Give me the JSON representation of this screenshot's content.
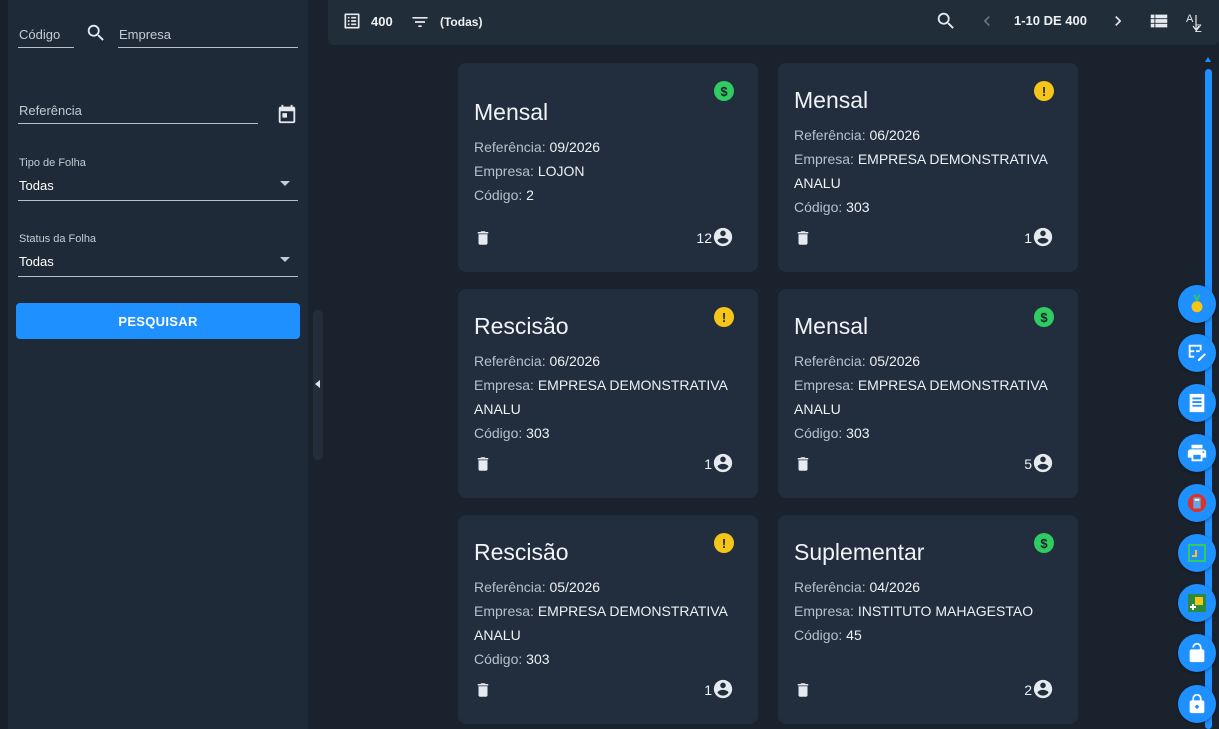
{
  "filters": {
    "codigo_placeholder": "Código",
    "empresa_placeholder": "Empresa",
    "referencia_placeholder": "Referência",
    "tipo_label": "Tipo de Folha",
    "tipo_value": "Todas",
    "status_label": "Status da Folha",
    "status_value": "Todas",
    "search_button": "PESQUISAR"
  },
  "toolbar": {
    "total": "400",
    "filter_text": "(Todas)",
    "pagination": "1-10 DE 400"
  },
  "labels": {
    "referencia": "Referência: ",
    "empresa": "Empresa: ",
    "codigo": "Código: "
  },
  "cards": [
    {
      "title": "Mensal",
      "referencia": "09/2026",
      "empresa": "LOJON",
      "codigo": "2",
      "count": "12",
      "status": "paid",
      "status_glyph": "$"
    },
    {
      "title": "Mensal",
      "referencia": "06/2026",
      "empresa": "EMPRESA DEMONSTRATIVA ANALU",
      "codigo": "303",
      "count": "1",
      "status": "warn",
      "status_glyph": "!"
    },
    {
      "title": "Rescisão",
      "referencia": "06/2026",
      "empresa": "EMPRESA DEMONSTRATIVA ANALU",
      "codigo": "303",
      "count": "1",
      "status": "warn",
      "status_glyph": "!"
    },
    {
      "title": "Mensal",
      "referencia": "05/2026",
      "empresa": "EMPRESA DEMONSTRATIVA ANALU",
      "codigo": "303",
      "count": "5",
      "status": "paid",
      "status_glyph": "$"
    },
    {
      "title": "Rescisão",
      "referencia": "05/2026",
      "empresa": "EMPRESA DEMONSTRATIVA ANALU",
      "codigo": "303",
      "count": "1",
      "status": "warn",
      "status_glyph": "!"
    },
    {
      "title": "Suplementar",
      "referencia": "04/2026",
      "empresa": "INSTITUTO MAHAGESTAO",
      "codigo": "45",
      "count": "2",
      "status": "paid",
      "status_glyph": "$"
    }
  ],
  "fab_icons": [
    "medal-icon",
    "table-edit-icon",
    "receipt-icon",
    "print-icon",
    "calculator-icon",
    "chart-frame-icon",
    "add-box-icon",
    "unlock-icon",
    "lock-icon"
  ],
  "colors": {
    "accent": "#1e90ff",
    "paid": "#2fcc61",
    "warn": "#f5c518",
    "card": "#222d3d",
    "sidebar": "#1f2a38"
  }
}
